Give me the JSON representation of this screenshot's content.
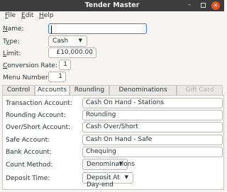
{
  "window": {
    "title": "Tender Master",
    "minimize_glyph": "–",
    "close_glyph": "✕"
  },
  "menubar": {
    "file": {
      "mnemonic": "F",
      "rest": "ile"
    },
    "edit": {
      "mnemonic": "E",
      "rest": "dit"
    },
    "help": {
      "mnemonic": "H",
      "rest": "elp"
    }
  },
  "form": {
    "name": {
      "mnemonic": "N",
      "rest": "ame:",
      "value": ""
    },
    "type": {
      "pre": "T",
      "mnemonic": "y",
      "rest": "pe:",
      "value": "Cash"
    },
    "limit": {
      "mnemonic": "L",
      "rest": "imit:",
      "value": "£10,000.00"
    },
    "conversion_rate": {
      "mnemonic": "C",
      "rest": "onversion Rate:",
      "value": "1"
    },
    "menu_number": {
      "label": "Menu Number:",
      "value": "1"
    }
  },
  "tabs": [
    {
      "label": "Control"
    },
    {
      "label": "Accounts"
    },
    {
      "label": "Rounding"
    },
    {
      "label": "Denominations"
    },
    {
      "label": "Gift Card Items"
    }
  ],
  "accounts": {
    "transaction": {
      "label": "Transaction Account:",
      "value": "Cash On Hand - Stations"
    },
    "rounding": {
      "label": "Rounding Account:",
      "value": "Rounding"
    },
    "over_short": {
      "label": "Over/Short Account:",
      "value": "Cash Over/Short"
    },
    "safe": {
      "label": "Safe Account:",
      "value": "Cash On Hand - Safe"
    },
    "bank": {
      "label": "Bank Account:",
      "value": "Chequing"
    },
    "count_method": {
      "label": "Count Method:",
      "value": "Denominations"
    },
    "deposit_time": {
      "label": "Deposit Time:",
      "value": "Deposit At Day-end"
    }
  },
  "icons": {
    "combo_arrow": "▼"
  }
}
